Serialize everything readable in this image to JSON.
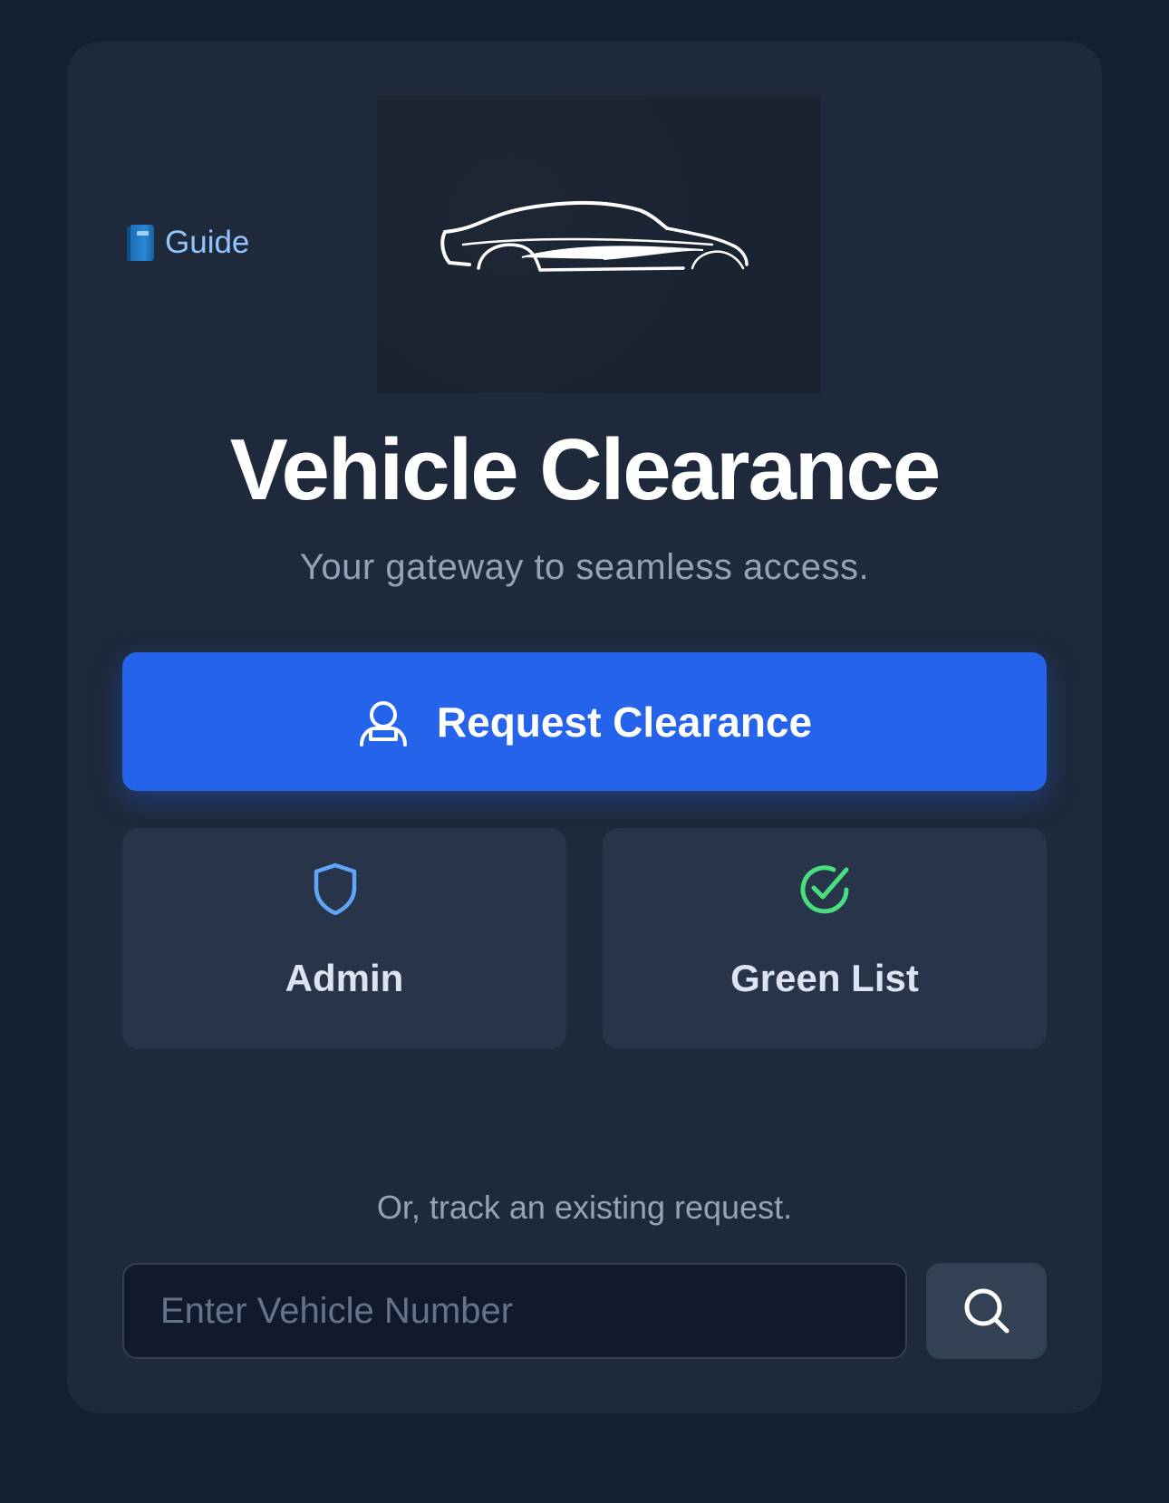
{
  "guide": {
    "icon": "blue-book-icon",
    "label": "Guide"
  },
  "hero": {
    "icon": "car-silhouette-icon"
  },
  "title": "Vehicle Clearance",
  "subtitle": "Your gateway to seamless access.",
  "primary_action": {
    "icon": "user-icon",
    "label": "Request Clearance"
  },
  "tiles": [
    {
      "icon": "shield-icon",
      "label": "Admin",
      "color": "#60a5fa"
    },
    {
      "icon": "check-circle-icon",
      "label": "Green List",
      "color": "#4ade80"
    }
  ],
  "track": {
    "label": "Or, track an existing request.",
    "placeholder": "Enter Vehicle Number",
    "value": "",
    "button_icon": "search-icon"
  },
  "colors": {
    "background": "#142030",
    "card": "#1e293b",
    "accent": "#2563eb",
    "link": "#93c5fd"
  }
}
